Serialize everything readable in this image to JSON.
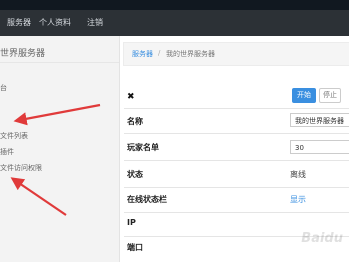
{
  "navbar": {
    "items": [
      "服务器",
      "个人资料",
      "注销"
    ]
  },
  "sidebar": {
    "title": "世界服务器",
    "items": [
      "",
      "台",
      "",
      "",
      "文件列表",
      "插件",
      "文件访问权限",
      "",
      "",
      "",
      ""
    ]
  },
  "breadcrumb": {
    "root": "服务器",
    "separator": "/",
    "current": "我的世界服务器"
  },
  "controls": {
    "start_label": "开始",
    "stop_label": "停止"
  },
  "rows": {
    "name": {
      "label": "名称",
      "value": "我的世界服务器"
    },
    "player": {
      "label": "玩家名单",
      "value": "30"
    },
    "status": {
      "label": "状态",
      "value": "离线"
    },
    "online_bar": {
      "label": "在线状态栏",
      "value": "显示"
    },
    "ip": {
      "label": "IP"
    },
    "port": {
      "label": "端口"
    }
  },
  "watermark": "Baidu",
  "colors": {
    "accent": "#3a8fe0",
    "navbar": "#2c3136",
    "annotation": "#e03a3a"
  },
  "icons": {
    "close": "close-icon"
  }
}
